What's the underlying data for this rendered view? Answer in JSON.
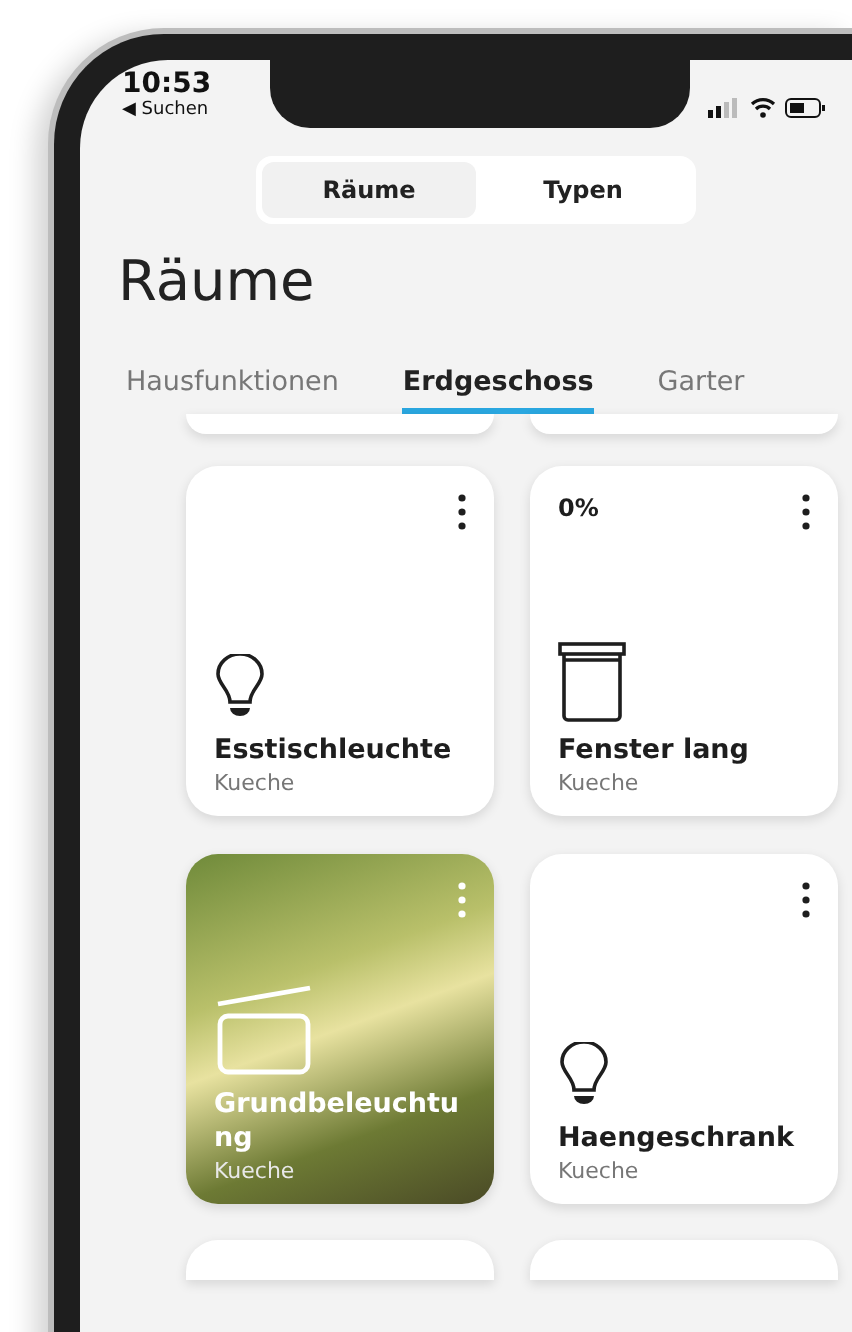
{
  "status_bar": {
    "time": "10:53",
    "back_link": "◀ Suchen"
  },
  "segments": [
    {
      "label": "Räume",
      "selected": true
    },
    {
      "label": "Typen",
      "selected": false
    }
  ],
  "title": "Räume",
  "floors": [
    {
      "label": "Hausfunktionen",
      "selected": false
    },
    {
      "label": "Erdgeschoss",
      "selected": true
    },
    {
      "label": "Garter",
      "selected": false
    }
  ],
  "devices": [
    {
      "kind": "light",
      "name": "Esstischleuchte",
      "room": "Kueche",
      "photo": false
    },
    {
      "kind": "blind",
      "value": "0%",
      "name": "Fenster lang",
      "room": "Kueche",
      "photo": false
    },
    {
      "kind": "box",
      "name": "Grundbeleuchtung",
      "room": "Kueche",
      "photo": true
    },
    {
      "kind": "light",
      "name": "Haengeschrank",
      "room": "Kueche",
      "photo": false
    }
  ]
}
